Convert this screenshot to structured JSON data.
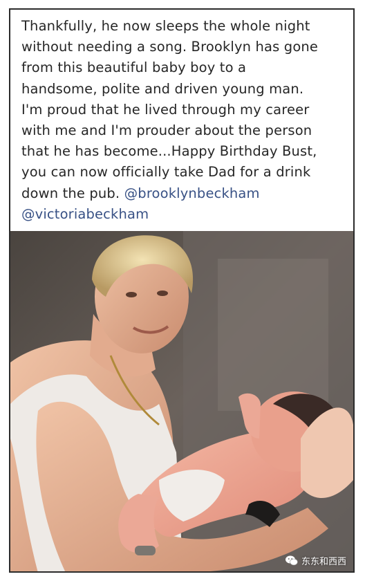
{
  "post": {
    "caption_lines": [
      "Thankfully, he now sleeps the whole night",
      "without needing a song. Brooklyn has gone",
      "from this beautiful baby boy to a",
      "handsome, polite and driven young man.",
      "I'm proud that he lived through my career",
      "with me and I'm prouder about the person",
      "that he has become...Happy Birthday Bust,",
      "you can now officially take Dad for a drink"
    ],
    "caption_last_line": "down the pub.",
    "mention_1": "@brooklynbeckham",
    "mention_2": "@victoriabeckham"
  },
  "photo": {
    "description_icon": "photo-of-man-holding-newborn",
    "watermark_icon": "wechat-icon",
    "watermark_text": "东东和西西"
  },
  "colors": {
    "text": "#262626",
    "mention": "#385185",
    "frame": "#2b2b2b"
  }
}
